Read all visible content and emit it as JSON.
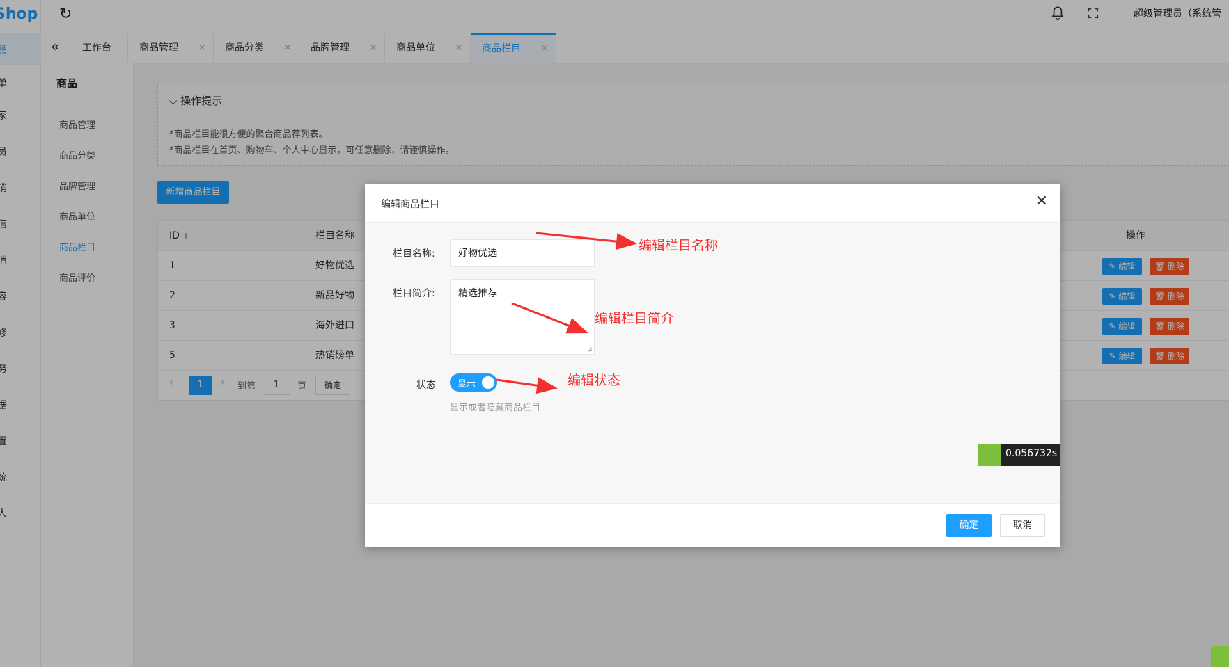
{
  "app": {
    "logo_text": "Shop"
  },
  "rail": {
    "items": [
      "品",
      "单",
      "家",
      "员",
      "销",
      "信",
      "消",
      "容",
      "修",
      "务",
      "据",
      "置",
      "统",
      "人"
    ]
  },
  "topbar": {
    "user": "超级管理员（系统管"
  },
  "tabs": [
    {
      "label": "工作台"
    },
    {
      "label": "商品管理"
    },
    {
      "label": "商品分类"
    },
    {
      "label": "品牌管理"
    },
    {
      "label": "商品单位"
    },
    {
      "label": "商品栏目"
    }
  ],
  "submenu": {
    "title": "商品",
    "items": [
      "商品管理",
      "商品分类",
      "品牌管理",
      "商品单位",
      "商品栏目",
      "商品评价"
    ]
  },
  "tips": {
    "heading": "操作提示",
    "lines": [
      "*商品栏目能很方便的聚合商品荐列表。",
      "*商品栏目在首页、购物车、个人中心显示，可任意删除，请谨慎操作。"
    ]
  },
  "toolbar": {
    "add_label": "新增商品栏目"
  },
  "table": {
    "headers": {
      "id": "ID",
      "name": "栏目名称",
      "op": "操作"
    },
    "rows": [
      {
        "id": "1",
        "name": "好物优选"
      },
      {
        "id": "2",
        "name": "新品好物"
      },
      {
        "id": "3",
        "name": "海外进口"
      },
      {
        "id": "5",
        "name": "热销磅单"
      }
    ],
    "edit_label": "编辑",
    "delete_label": "删除"
  },
  "pager": {
    "current": "1",
    "goto_label": "到第",
    "input_value": "1",
    "page_label": "页",
    "ok_label": "确定"
  },
  "modal": {
    "title": "编辑商品栏目",
    "name_label": "栏目名称:",
    "name_value": "好物优选",
    "intro_label": "栏目简介:",
    "intro_value": "精选推荐",
    "status_label": "状态",
    "status_on_label": "显示",
    "status_help": "显示或者隐藏商品栏目",
    "ok_label": "确定",
    "cancel_label": "取消"
  },
  "annotations": {
    "name": "编辑栏目名称",
    "intro": "编辑栏目简介",
    "status": "编辑状态"
  },
  "debug_badge": "0.056732s",
  "colors": {
    "accent": "#1e9fff",
    "danger": "#ff5722",
    "annotation": "#f23030"
  }
}
